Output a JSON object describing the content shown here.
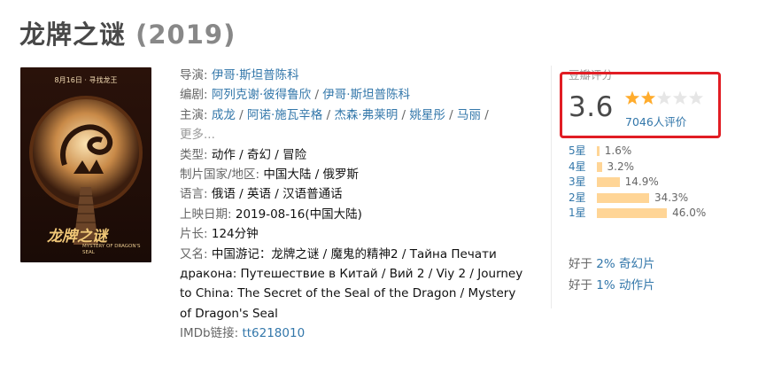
{
  "title": {
    "name": "龙牌之谜",
    "year": "(2019)"
  },
  "poster": {
    "top_text": "8月16日 · 寻找龙王",
    "logo_cn": "龙牌之谜",
    "logo_en": "MYSTERY OF DRAGON'S SEAL"
  },
  "info": {
    "director_label": "导演:",
    "director": "伊哥·斯坦普陈科",
    "writer_label": "编剧:",
    "writer_1": "阿列克谢·彼得鲁欣",
    "writer_sep": " / ",
    "writer_2": "伊哥·斯坦普陈科",
    "cast_label": "主演:",
    "cast": [
      "成龙",
      "阿诺·施瓦辛格",
      "杰森·弗莱明",
      "姚星彤",
      "马丽"
    ],
    "cast_sep": " / ",
    "more": "更多...",
    "genre_label": "类型:",
    "genre": "动作 / 奇幻 / 冒险",
    "country_label": "制片国家/地区:",
    "country": "中国大陆 / 俄罗斯",
    "lang_label": "语言:",
    "lang": "俄语 / 英语 / 汉语普通话",
    "release_label": "上映日期:",
    "release": "2019-08-16(中国大陆)",
    "runtime_label": "片长:",
    "runtime": "124分钟",
    "aka_label": "又名:",
    "aka_1": "中国游记：龙牌之谜 / 魔鬼的精神2 / Тайна Печати",
    "aka_2": "дракона: Путешествие в Китай / Вий 2 / Viy 2 / Journey",
    "aka_3": "to China: The Secret of the Seal of the Dragon / Mystery",
    "aka_4": "of Dragon's Seal",
    "imdb_label": "IMDb链接:",
    "imdb": "tt6218010"
  },
  "rating": {
    "label": "豆瓣评分",
    "score": "3.6",
    "stars_value": 2,
    "stars_max": 5,
    "votes": "7046人评价",
    "highlight_color": "#e11d24",
    "star_color": "#ffac2d",
    "distribution": [
      {
        "label": "5星",
        "percent": 1.6,
        "text": "1.6%"
      },
      {
        "label": "4星",
        "percent": 3.2,
        "text": "3.2%"
      },
      {
        "label": "3星",
        "percent": 14.9,
        "text": "14.9%"
      },
      {
        "label": "2星",
        "percent": 34.3,
        "text": "34.3%"
      },
      {
        "label": "1星",
        "percent": 46.0,
        "text": "46.0%"
      }
    ]
  },
  "better_than": [
    {
      "prefix": "好于 ",
      "value": "2% 奇幻片"
    },
    {
      "prefix": "好于 ",
      "value": "1% 动作片"
    }
  ]
}
